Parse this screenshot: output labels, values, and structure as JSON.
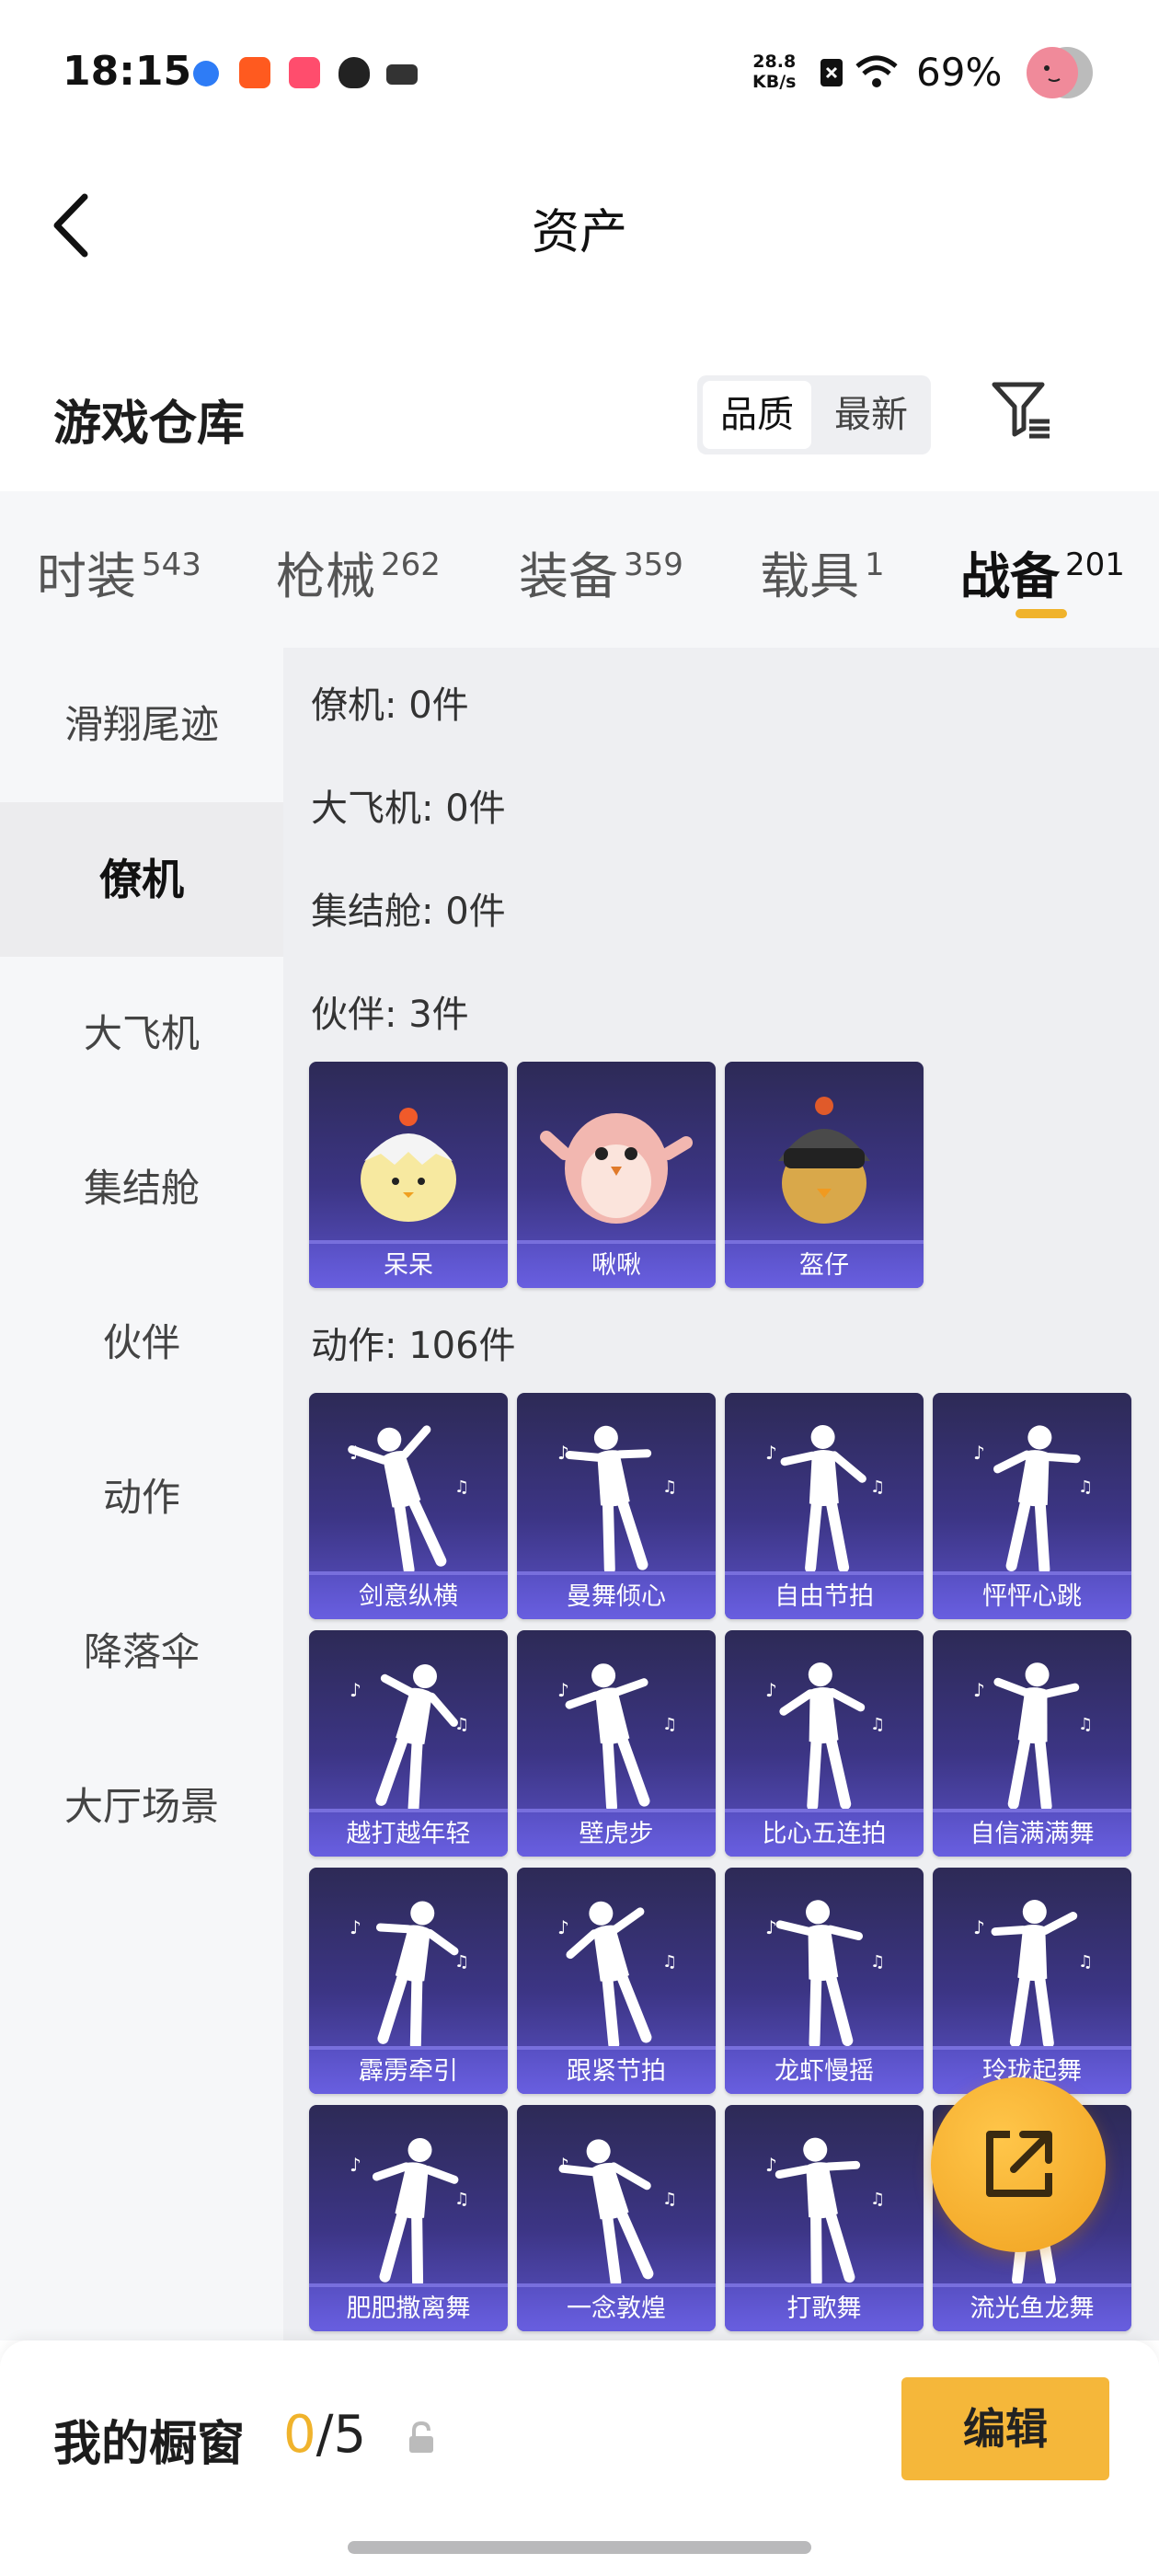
{
  "status_bar": {
    "time": "18:15",
    "net_speed_value": "28.8",
    "net_speed_unit": "KB/s",
    "battery": "69%"
  },
  "nav": {
    "title": "资产"
  },
  "warehouse": {
    "title": "游戏仓库",
    "sort_quality": "品质",
    "sort_latest": "最新"
  },
  "tabs": [
    {
      "label": "时装",
      "count": "543"
    },
    {
      "label": "枪械",
      "count": "262"
    },
    {
      "label": "装备",
      "count": "359"
    },
    {
      "label": "载具",
      "count": "1"
    },
    {
      "label": "战备",
      "count": "201"
    }
  ],
  "sidebar": [
    "滑翔尾迹",
    "僚机",
    "大飞机",
    "集结舱",
    "伙伴",
    "动作",
    "降落伞",
    "大厅场景"
  ],
  "sections": {
    "wingman": "僚机: 0件",
    "plane": "大飞机: 0件",
    "capsule": "集结舱: 0件",
    "companion": "伙伴: 3件",
    "emote": "动作: 106件"
  },
  "companions": [
    "呆呆",
    "啾啾",
    "盔仔"
  ],
  "emotes": [
    "剑意纵横",
    "曼舞倾心",
    "自由节拍",
    "怦怦心跳",
    "越打越年轻",
    "壁虎步",
    "比心五连拍",
    "自信满满舞",
    "霹雳牵引",
    "跟紧节拍",
    "龙虾慢摇",
    "玲珑起舞",
    "肥肥撒离舞",
    "一念敦煌",
    "打歌舞",
    "流光鱼龙舞"
  ],
  "showcase": {
    "label": "我的橱窗",
    "current": "0",
    "total": "/5",
    "edit": "编辑"
  },
  "colors": {
    "accent": "#f0b32c",
    "card_bg": "#3c3585"
  }
}
